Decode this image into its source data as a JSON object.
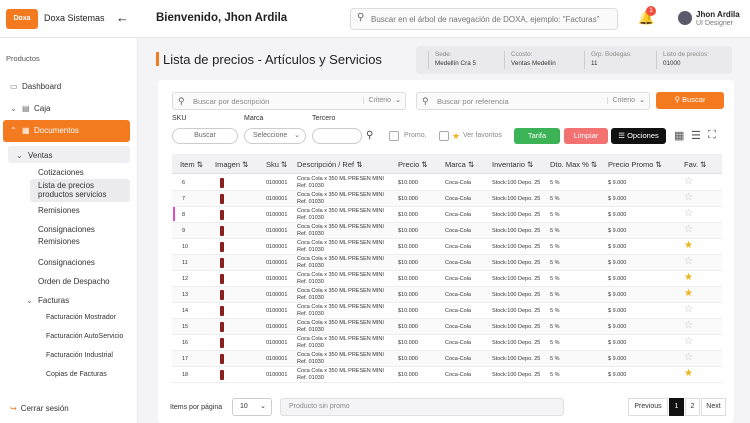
{
  "header": {
    "logo_text": "Doxa",
    "brand": "Doxa Sistemas",
    "welcome": "Bienvenido, Jhon Ardila",
    "search_placeholder": "Buscar en el árbol de navegación de DOXA, ejemplo: \"Facturas\"",
    "notification_count": "1",
    "user_name": "Jhon Ardila",
    "user_role": "UI Designer"
  },
  "sidebar": {
    "section_label": "Productos",
    "dashboard": "Dashboard",
    "caja": "Caja",
    "documentos": "Documentos",
    "ventas": "Ventas",
    "cotizaciones": "Cotizaciones",
    "lista_precios_1": "Lista de precios",
    "lista_precios_2": "productos servicios",
    "remisiones": "Remisiones",
    "consignaciones_1": "Consignaciones",
    "consignaciones_2": "Remisiones",
    "consignaciones": "Consignaciones",
    "orden_despacho": "Orden de Despacho",
    "facturas": "Facturas",
    "fact_mostrador": "Facturación Mostrador",
    "fact_autoservicio": "Facturación AutoServicio",
    "fact_industrial": "Facturación Industrial",
    "copias_facturas": "Copias de Facturas",
    "logout": "Cerrar sesión"
  },
  "page": {
    "title": "Lista de precios - Artículos y Servicios",
    "info": [
      {
        "label": "Sede:",
        "value": "Medellín Cra 5"
      },
      {
        "label": "Ccosto:",
        "value": "Ventas Medellín"
      },
      {
        "label": "Grp. Bodegas:",
        "value": "11"
      },
      {
        "label": "Listo de precios:",
        "value": "01000"
      }
    ]
  },
  "filters": {
    "desc_placeholder": "Buscar por descripción",
    "ref_placeholder": "Buscar por referencia",
    "criterio": "Criterio",
    "buscar_btn": "Buscar",
    "sku_label": "SKU",
    "sku_button": "Buscar",
    "marca_label": "Marca",
    "marca_select": "Seleccione",
    "tercero_label": "Tercero",
    "promo_label": "Promo.",
    "favoritos_label": "Ver favoritos",
    "tarifa_btn": "Tarifa",
    "limpiar_btn": "Limpiar",
    "opciones_btn": "Opciones",
    "colors": {
      "orange": "#f47a20",
      "green": "#3cb356",
      "red": "#f27272",
      "dark": "#111111"
    }
  },
  "table": {
    "headers": [
      "Item",
      "Imagen",
      "Sku",
      "Descripción / Ref",
      "Precio",
      "Marca",
      "Inventario",
      "Dto. Max %",
      "Precio Promo",
      "Fav."
    ],
    "desc_line1": "Coca Cola x 350 ML PRESEN MINI",
    "desc_line2": "Ref. 01030",
    "sku": "0100001",
    "price": "$10.000",
    "brand": "Coca-Cola",
    "inventory": "Stock:100 Depo. 25",
    "discount": "5 %",
    "promo_price": "$ 9.000",
    "rows": [
      {
        "item": "6",
        "fav": false
      },
      {
        "item": "7",
        "fav": false
      },
      {
        "item": "8",
        "fav": false
      },
      {
        "item": "9",
        "fav": false
      },
      {
        "item": "10",
        "fav": true
      },
      {
        "item": "11",
        "fav": false
      },
      {
        "item": "12",
        "fav": true
      },
      {
        "item": "13",
        "fav": true
      },
      {
        "item": "14",
        "fav": false
      },
      {
        "item": "15",
        "fav": false
      },
      {
        "item": "16",
        "fav": false
      },
      {
        "item": "17",
        "fav": false
      },
      {
        "item": "18",
        "fav": true
      }
    ]
  },
  "footer": {
    "items_label": "Items por página",
    "per_page": "10",
    "promo_placeholder": "Producto sin promo",
    "prev": "Previous",
    "page1": "1",
    "page2": "2",
    "next": "Next"
  }
}
